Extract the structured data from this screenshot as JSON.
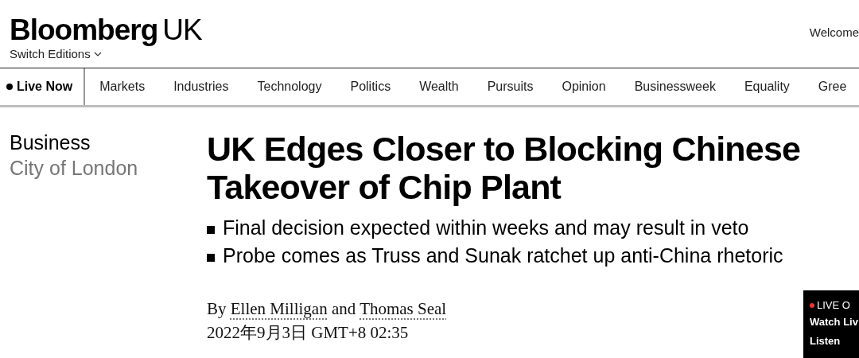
{
  "header": {
    "logo": "Bloomberg",
    "edition": "UK",
    "switch_editions": "Switch Editions",
    "welcome": "Welcome"
  },
  "nav": {
    "items": [
      {
        "label": "Live Now",
        "kind": "live",
        "selected": false
      },
      {
        "label": "Markets",
        "kind": "link",
        "selected": false
      },
      {
        "label": "Industries",
        "kind": "link",
        "selected": false
      },
      {
        "label": "Technology",
        "kind": "link",
        "selected": false
      },
      {
        "label": "Politics",
        "kind": "link",
        "selected": false
      },
      {
        "label": "Wealth",
        "kind": "link",
        "selected": false
      },
      {
        "label": "Pursuits",
        "kind": "link",
        "selected": false
      },
      {
        "label": "Opinion",
        "kind": "link",
        "selected": false
      },
      {
        "label": "Businessweek",
        "kind": "link",
        "selected": false
      },
      {
        "label": "Equality",
        "kind": "link",
        "selected": false
      },
      {
        "label": "Gree",
        "kind": "link",
        "selected": false
      }
    ]
  },
  "article": {
    "section": "Business",
    "subsection": "City of London",
    "headline": "UK Edges Closer to Blocking Chinese Takeover of Chip Plant",
    "bullets": [
      "Final decision expected within weeks and may result in veto",
      "Probe comes as Truss and Sunak ratchet up anti-China rhetoric"
    ],
    "byline": {
      "prefix": "By",
      "authors": [
        "Ellen Milligan",
        "Thomas Seal"
      ],
      "joiner": "and"
    },
    "date": "2022年9月3日 GMT+8 02:35"
  },
  "live_widget": {
    "label": "LIVE O",
    "watch": "Watch Liv",
    "listen": "Listen"
  }
}
